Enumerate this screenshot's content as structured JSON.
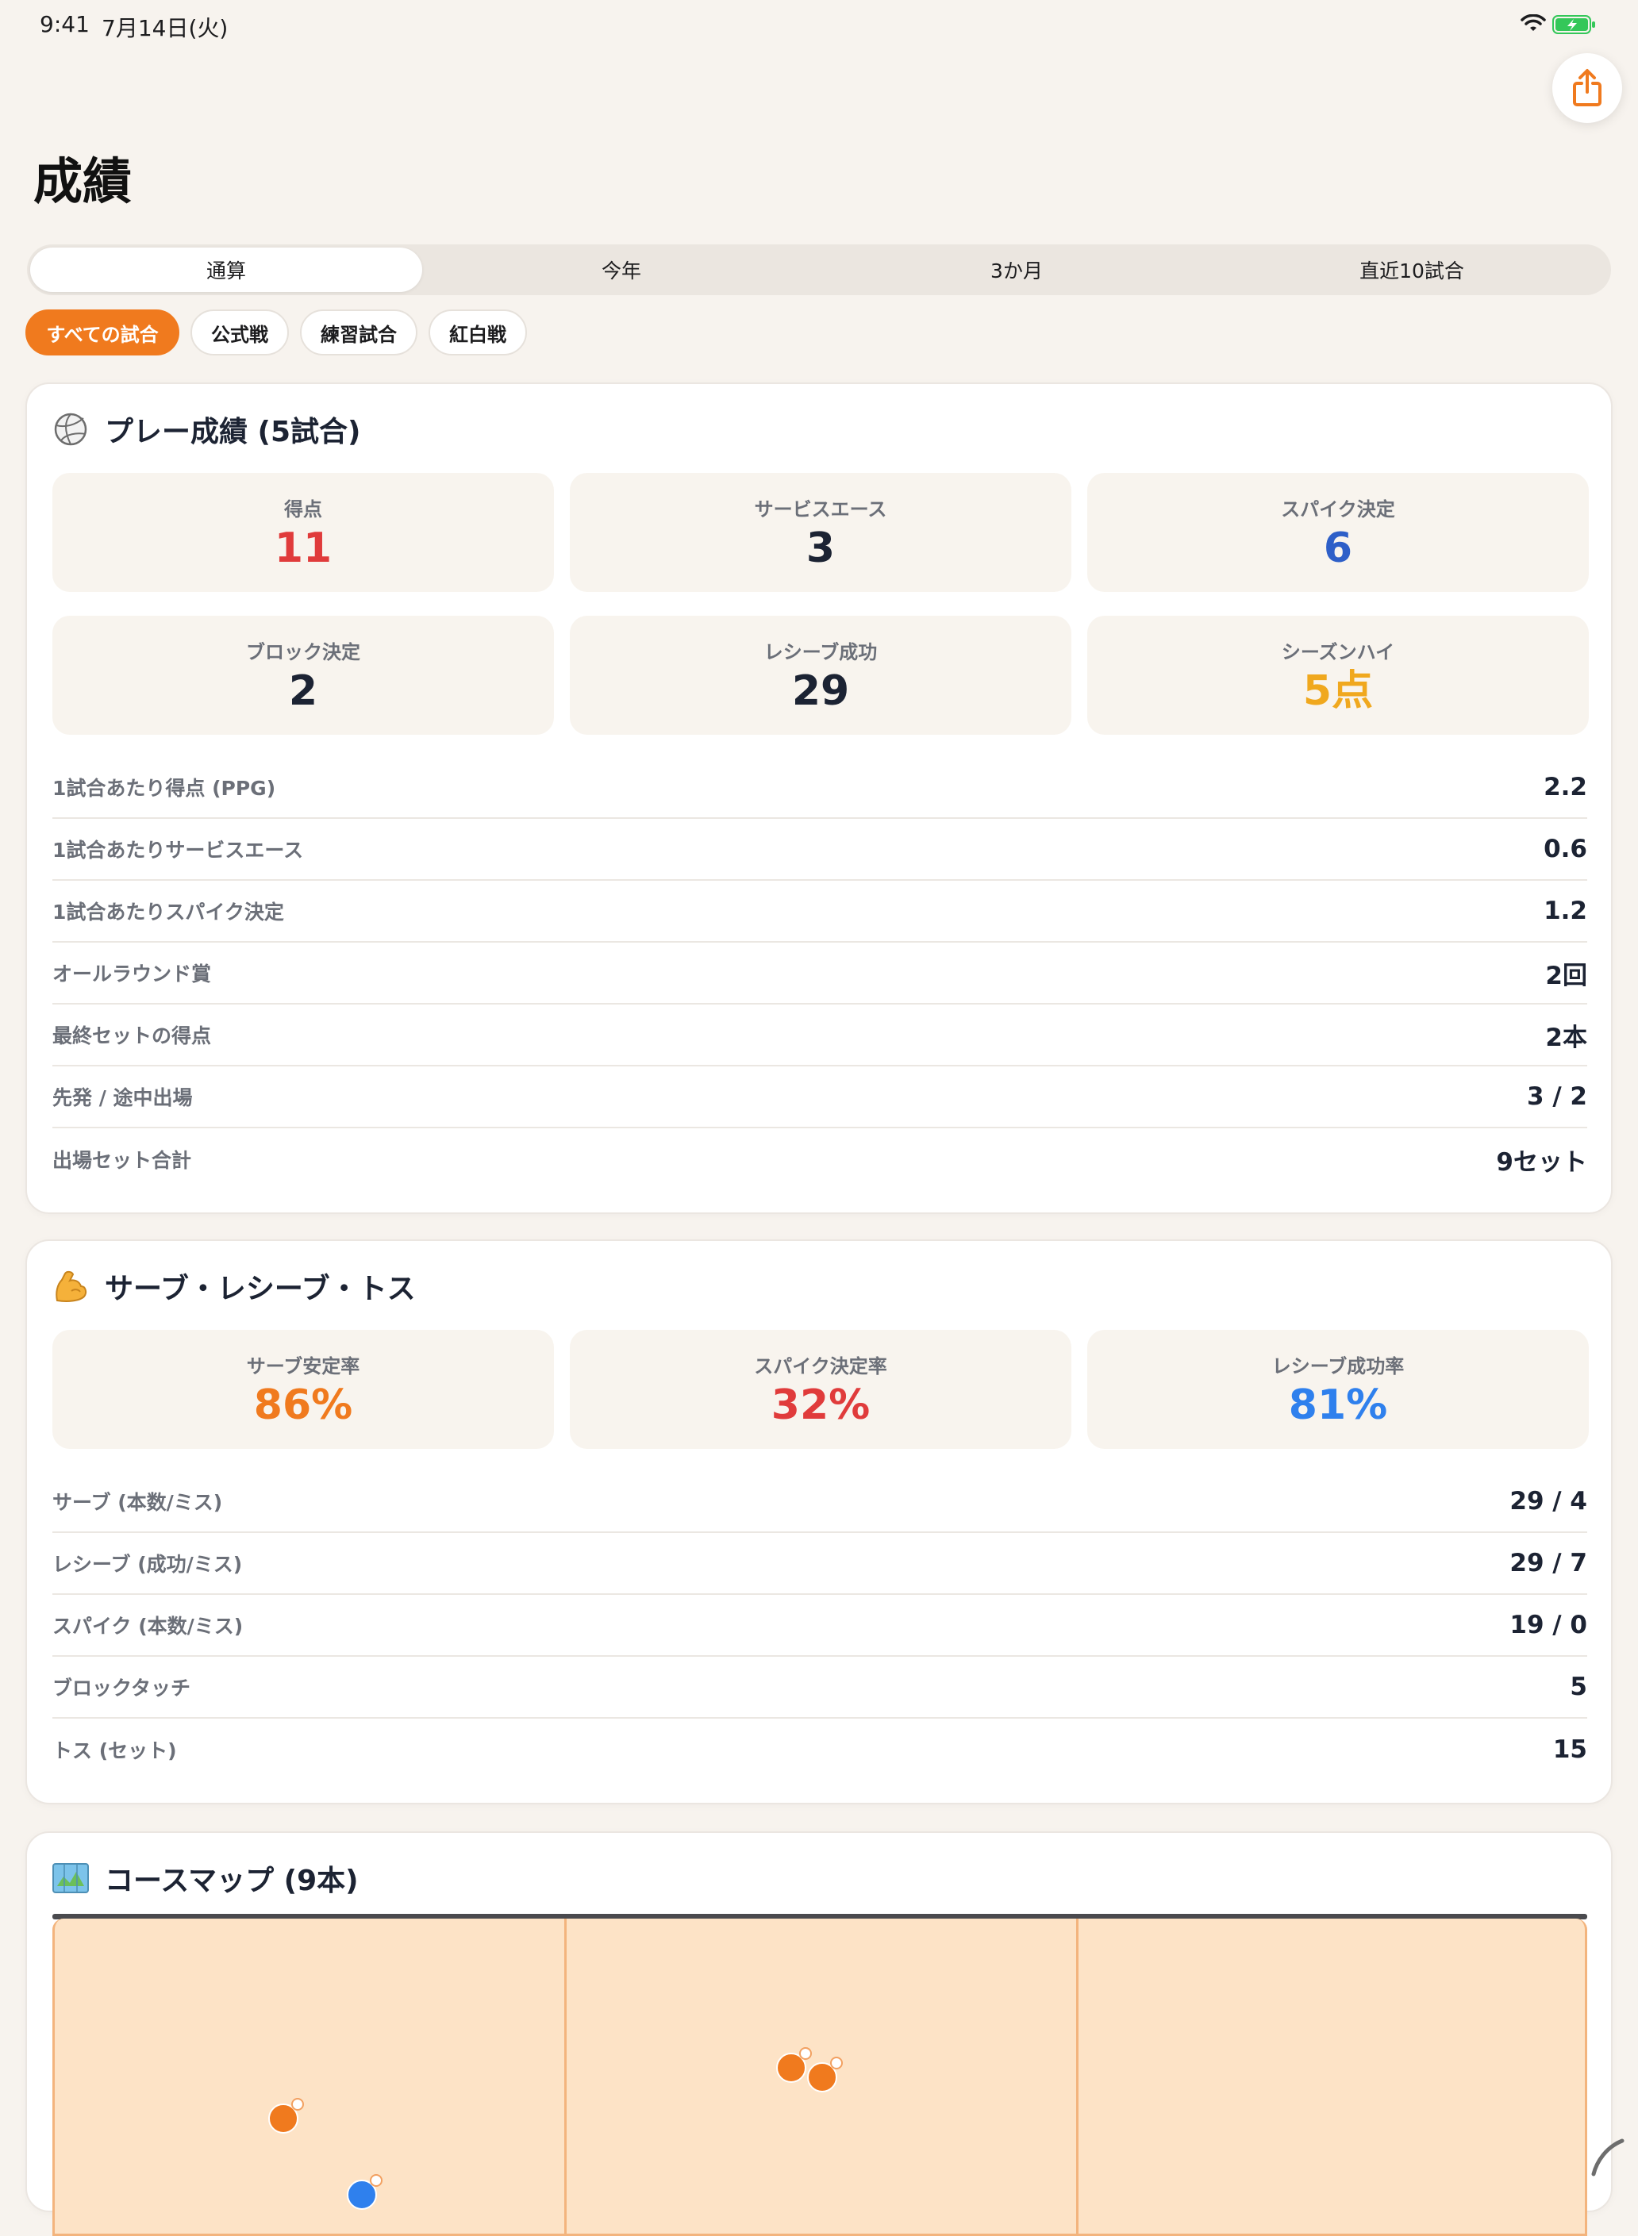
{
  "status_bar": {
    "time": "9:41",
    "date": "7月14日(火)"
  },
  "page": {
    "title": "成績"
  },
  "period_tabs": [
    "通算",
    "今年",
    "3か月",
    "直近10試合"
  ],
  "active_period": 0,
  "filters": [
    "すべての試合",
    "公式戦",
    "練習試合",
    "紅白戦"
  ],
  "active_filter": 0,
  "colors": {
    "accent": "#f07a1e",
    "red": "#e03b3b",
    "blue": "#2e5fc8",
    "gold": "#f0a81e",
    "light_blue": "#2f80ed"
  },
  "play_stats": {
    "icon": "volleyball-icon",
    "title": "プレー成績 (5試合)",
    "tiles": [
      {
        "label": "得点",
        "value": "11",
        "color": "#e03b3b"
      },
      {
        "label": "サービスエース",
        "value": "3",
        "color": "#1c2333"
      },
      {
        "label": "スパイク決定",
        "value": "6",
        "color": "#2e5fc8"
      },
      {
        "label": "ブロック決定",
        "value": "2",
        "color": "#1c2333"
      },
      {
        "label": "レシーブ成功",
        "value": "29",
        "color": "#1c2333"
      },
      {
        "label": "シーズンハイ",
        "value": "5点",
        "color": "#f0a81e"
      }
    ],
    "rows": [
      {
        "label": "1試合あたり得点 (PPG)",
        "value": "2.2"
      },
      {
        "label": "1試合あたりサービスエース",
        "value": "0.6"
      },
      {
        "label": "1試合あたりスパイク決定",
        "value": "1.2"
      },
      {
        "label": "オールラウンド賞",
        "value": "2回"
      },
      {
        "label": "最終セットの得点",
        "value": "2本"
      },
      {
        "label": "先発 / 途中出場",
        "value": "3 / 2"
      },
      {
        "label": "出場セット合計",
        "value": "9セット"
      }
    ]
  },
  "serve_stats": {
    "icon": "flexed-biceps-icon",
    "title": "サーブ・レシーブ・トス",
    "tiles": [
      {
        "label": "サーブ安定率",
        "value": "86%",
        "color": "#f07a1e"
      },
      {
        "label": "スパイク決定率",
        "value": "32%",
        "color": "#e03b3b"
      },
      {
        "label": "レシーブ成功率",
        "value": "81%",
        "color": "#2f80ed"
      }
    ],
    "rows": [
      {
        "label": "サーブ (本数/ミス)",
        "value": "29 / 4"
      },
      {
        "label": "レシーブ (成功/ミス)",
        "value": "29 / 7"
      },
      {
        "label": "スパイク (本数/ミス)",
        "value": "19 / 0"
      },
      {
        "label": "ブロックタッチ",
        "value": "5"
      },
      {
        "label": "トス (セット)",
        "value": "15"
      }
    ]
  },
  "course_map": {
    "icon": "map-icon",
    "title": "コースマップ (9本)",
    "points": [
      {
        "x": 0.149,
        "y": 0.63,
        "color": "#f07a1e"
      },
      {
        "x": 0.48,
        "y": 0.47,
        "color": "#f07a1e"
      },
      {
        "x": 0.5,
        "y": 0.5,
        "color": "#f07a1e"
      },
      {
        "x": 0.2,
        "y": 0.87,
        "color": "#2f80ed"
      }
    ]
  }
}
